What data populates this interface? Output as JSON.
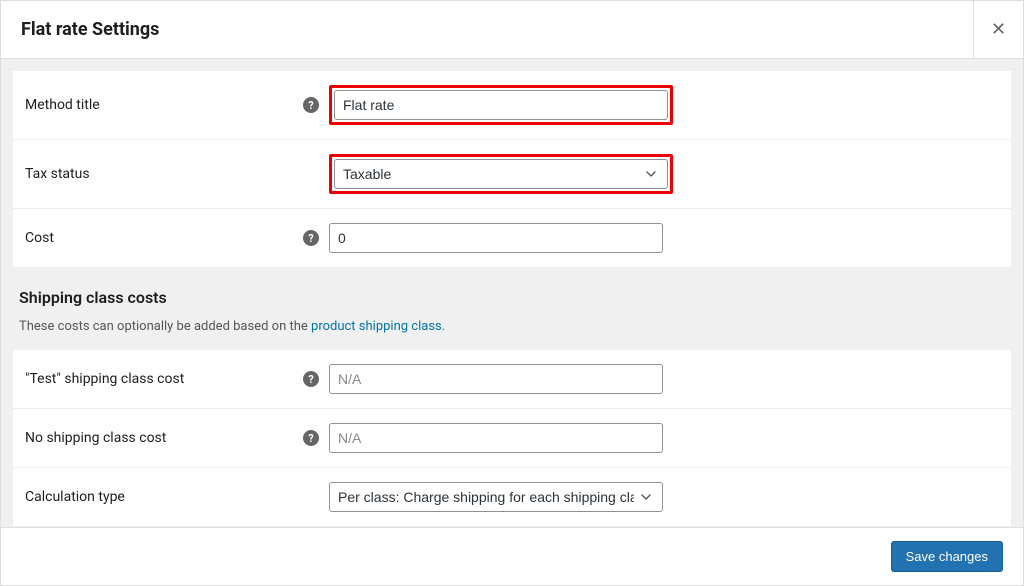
{
  "header": {
    "title": "Flat rate Settings"
  },
  "fields": {
    "method_title": {
      "label": "Method title",
      "value": "Flat rate"
    },
    "tax_status": {
      "label": "Tax status",
      "value": "Taxable"
    },
    "cost": {
      "label": "Cost",
      "value": "0"
    }
  },
  "shipping_section": {
    "heading": "Shipping class costs",
    "desc_prefix": "These costs can optionally be added based on the ",
    "desc_link": "product shipping class",
    "desc_suffix": "."
  },
  "shipping_fields": {
    "test_class": {
      "label": "\"Test\" shipping class cost",
      "placeholder": "N/A"
    },
    "no_class": {
      "label": "No shipping class cost",
      "placeholder": "N/A"
    },
    "calc_type": {
      "label": "Calculation type",
      "value": "Per class: Charge shipping for each shipping class individually"
    }
  },
  "footer": {
    "save": "Save changes"
  }
}
